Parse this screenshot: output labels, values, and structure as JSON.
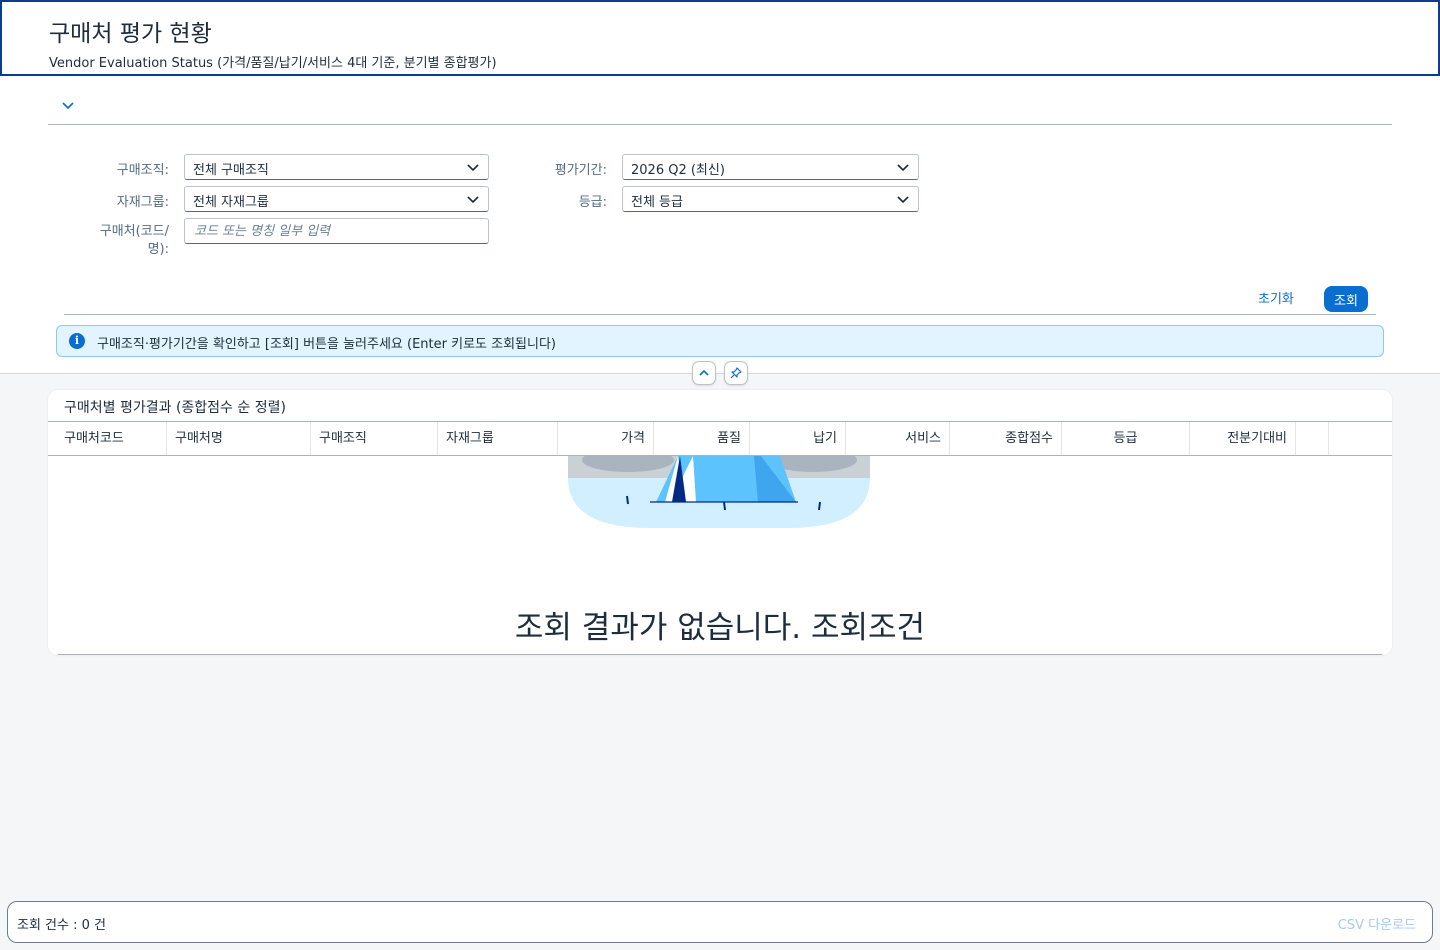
{
  "header": {
    "title": "구매처 평가 현황",
    "subtitle": "Vendor Evaluation Status (가격/품질/납기/서비스 4대 기준, 분기별 종합평가)"
  },
  "filters": {
    "purchase_org": {
      "label": "구매조직:",
      "value": "전체 구매조직"
    },
    "material_group": {
      "label": "자재그룹:",
      "value": "전체 자재그룹"
    },
    "vendor": {
      "label_line1": "구매처(코드/",
      "label_line2": "명):",
      "placeholder": "코드 또는 명칭 일부 입력"
    },
    "period": {
      "label": "평가기간:",
      "value": "2026 Q2 (최신)"
    },
    "grade": {
      "label": "등급:",
      "value": "전체 등급"
    }
  },
  "actions": {
    "reset_label": "초기화",
    "search_label": "조회"
  },
  "info": {
    "text": "구매조직·평가기간을 확인하고 [조회] 버튼을 눌러주세요 (Enter 키로도 조회됩니다)"
  },
  "results": {
    "title": "구매처별 평가결과 (종합점수 순 정렬)",
    "columns": [
      "구매처코드",
      "구매처명",
      "구매조직",
      "자재그룹",
      "가격",
      "품질",
      "납기",
      "서비스",
      "종합점수",
      "등급",
      "전분기대비"
    ],
    "no_data": "조회 결과가 없습니다. 조회조건"
  },
  "footer": {
    "count": "조회 건수 : 0 건",
    "csv_label": "CSV 다운로드"
  },
  "colors": {
    "brand_blue": "#0a6ed1",
    "header_border": "#0a3d91",
    "info_bg": "#e1f4ff"
  }
}
